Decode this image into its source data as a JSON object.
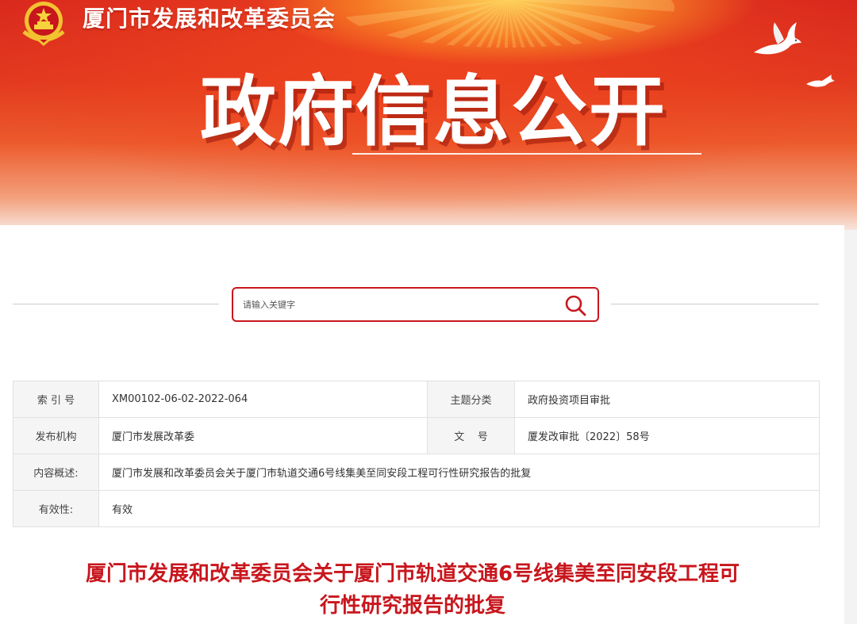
{
  "header": {
    "site_name": "厦门市发展和改革委员会",
    "section_title": "政府信息公开",
    "brand_color": "#d9281e",
    "emblem_icon": "national-emblem-icon",
    "decor_icon": "dove-icon"
  },
  "search": {
    "placeholder": "请输入关键字",
    "value": "",
    "icon": "search-icon",
    "accent_color": "#c8161d"
  },
  "meta": {
    "row1": {
      "label_a": "索 引 号",
      "value_a": "XM00102-06-02-2022-064",
      "label_b": "主题分类",
      "value_b": "政府投资项目审批"
    },
    "row2": {
      "label_a": "发布机构",
      "value_a": "厦门市发展改革委",
      "label_b": "文    号",
      "value_b": "厦发改审批〔2022〕58号"
    },
    "row3": {
      "label": "内容概述:",
      "value": "厦门市发展和改革委员会关于厦门市轨道交通6号线集美至同安段工程可行性研究报告的批复"
    },
    "row4": {
      "label": "有效性:",
      "value": "有效"
    }
  },
  "document": {
    "title_line1": "厦门市发展和改革委员会关于厦门市轨道交通6号线集美至同安段工程可",
    "title_line2": "行性研究报告的批复",
    "title_color": "#c8161d"
  }
}
